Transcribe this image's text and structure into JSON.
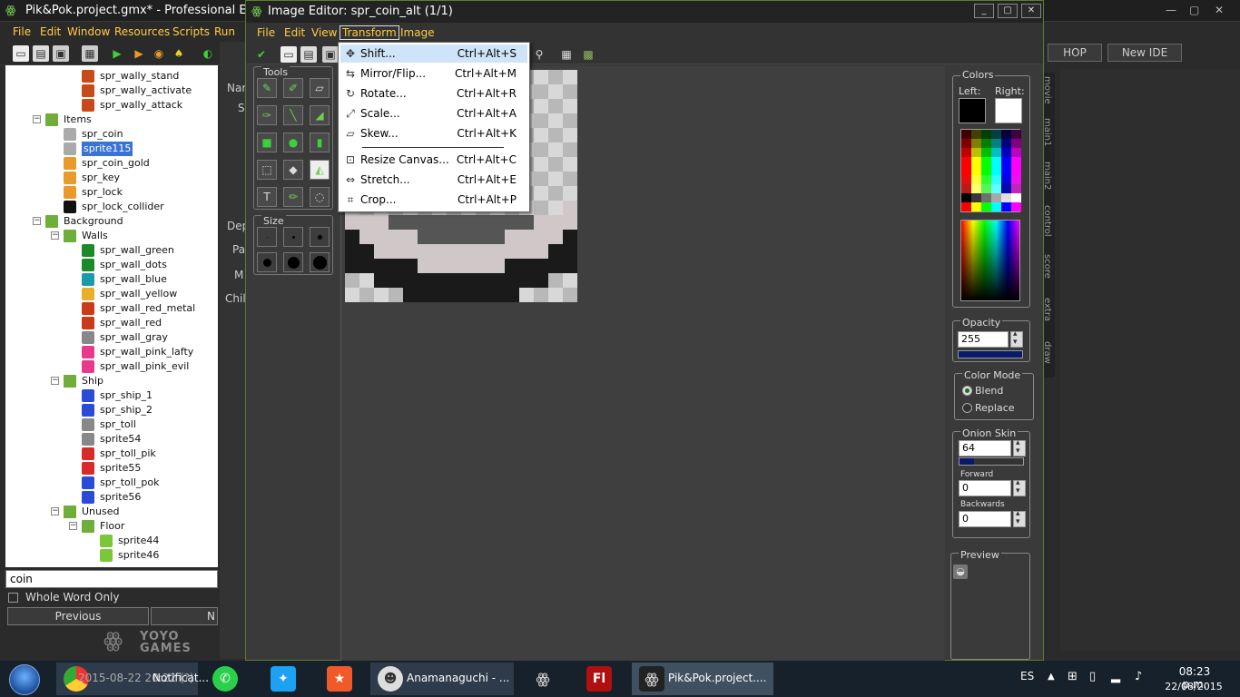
{
  "main": {
    "title": "Pik&Pok.project.gmx*  -  Professional Edition",
    "menu": [
      "File",
      "Edit",
      "Window",
      "Resources",
      "Scripts",
      "Run"
    ],
    "right_buttons": [
      "HOP",
      "New IDE"
    ],
    "right_tabs": [
      "movie",
      "main1",
      "main2",
      "control",
      "score",
      "extra",
      "draw"
    ]
  },
  "tree": {
    "items": [
      {
        "label": "spr_wally_stand",
        "depth": 4,
        "type": "sprite",
        "color": "#c84a1a"
      },
      {
        "label": "spr_wally_activate",
        "depth": 4,
        "type": "sprite",
        "color": "#c84a1a"
      },
      {
        "label": "spr_wally_attack",
        "depth": 4,
        "type": "sprite",
        "color": "#c84a1a"
      },
      {
        "label": "Items",
        "depth": 2,
        "type": "folder"
      },
      {
        "label": "spr_coin",
        "depth": 3,
        "type": "sprite",
        "color": "#aaaaaa"
      },
      {
        "label": "sprite115",
        "depth": 3,
        "type": "sprite",
        "color": "#aaaaaa",
        "selected": true
      },
      {
        "label": "spr_coin_gold",
        "depth": 3,
        "type": "sprite",
        "color": "#e89a2a"
      },
      {
        "label": "spr_key",
        "depth": 3,
        "type": "sprite",
        "color": "#e89a2a"
      },
      {
        "label": "spr_lock",
        "depth": 3,
        "type": "sprite",
        "color": "#e89a2a"
      },
      {
        "label": "spr_lock_collider",
        "depth": 3,
        "type": "sprite",
        "color": "#111111"
      },
      {
        "label": "Background",
        "depth": 2,
        "type": "folder"
      },
      {
        "label": "Walls",
        "depth": 3,
        "type": "folder"
      },
      {
        "label": "spr_wall_green",
        "depth": 4,
        "type": "sprite",
        "color": "#1a8a2a"
      },
      {
        "label": "spr_wall_dots",
        "depth": 4,
        "type": "sprite",
        "color": "#1a8a2a"
      },
      {
        "label": "spr_wall_blue",
        "depth": 4,
        "type": "sprite",
        "color": "#1a9aaa"
      },
      {
        "label": "spr_wall_yellow",
        "depth": 4,
        "type": "sprite",
        "color": "#e8b02a"
      },
      {
        "label": "spr_wall_red_metal",
        "depth": 4,
        "type": "sprite",
        "color": "#c83a1a"
      },
      {
        "label": "spr_wall_red",
        "depth": 4,
        "type": "sprite",
        "color": "#c83a1a"
      },
      {
        "label": "spr_wall_gray",
        "depth": 4,
        "type": "sprite",
        "color": "#888888"
      },
      {
        "label": "spr_wall_pink_lafty",
        "depth": 4,
        "type": "sprite",
        "color": "#e83a8a"
      },
      {
        "label": "spr_wall_pink_evil",
        "depth": 4,
        "type": "sprite",
        "color": "#e83a8a"
      },
      {
        "label": "Ship",
        "depth": 3,
        "type": "folder"
      },
      {
        "label": "spr_ship_1",
        "depth": 4,
        "type": "sprite",
        "color": "#2a4ad8"
      },
      {
        "label": "spr_ship_2",
        "depth": 4,
        "type": "sprite",
        "color": "#2a4ad8"
      },
      {
        "label": "spr_toll",
        "depth": 4,
        "type": "sprite",
        "color": "#888888"
      },
      {
        "label": "sprite54",
        "depth": 4,
        "type": "sprite",
        "color": "#888888"
      },
      {
        "label": "spr_toll_pik",
        "depth": 4,
        "type": "sprite",
        "color": "#d82a2a"
      },
      {
        "label": "sprite55",
        "depth": 4,
        "type": "sprite",
        "color": "#d82a2a"
      },
      {
        "label": "spr_toll_pok",
        "depth": 4,
        "type": "sprite",
        "color": "#2a4ad8"
      },
      {
        "label": "sprite56",
        "depth": 4,
        "type": "sprite",
        "color": "#2a4ad8"
      },
      {
        "label": "Unused",
        "depth": 3,
        "type": "folder"
      },
      {
        "label": "Floor",
        "depth": 4,
        "type": "folder"
      },
      {
        "label": "sprite44",
        "depth": 5,
        "type": "sprite",
        "color": "#7ac83a"
      },
      {
        "label": "sprite46",
        "depth": 5,
        "type": "sprite",
        "color": "#7ac83a"
      }
    ],
    "search_value": "coin",
    "whole_word_label": "Whole Word Only",
    "previous_label": "Previous",
    "next_label": "N"
  },
  "logo": {
    "line1": "YOYO",
    "line2": "GAMES"
  },
  "mid_panel": {
    "labels": [
      "Nar",
      "S",
      "Dep",
      "Pa",
      "M",
      "Chil"
    ]
  },
  "editor": {
    "title": "Image Editor: spr_coin_alt (1/1)",
    "menu": [
      "File",
      "Edit",
      "View",
      "Transform",
      "Image"
    ],
    "active_menu": "Transform",
    "tools_caption": "Tools",
    "size_caption": "Size",
    "colors_caption": "Colors",
    "left_label": "Left:",
    "right_label": "Right:",
    "opacity_caption": "Opacity",
    "opacity_value": "255",
    "color_mode_caption": "Color Mode",
    "blend_label": "Blend",
    "replace_label": "Replace",
    "onion_caption": "Onion Skin",
    "onion_value": "64",
    "forward_label": "Forward",
    "forward_value": "0",
    "backwards_label": "Backwards",
    "backwards_value": "0",
    "preview_caption": "Preview"
  },
  "transform_menu": [
    {
      "label": "Shift...",
      "shortcut": "Ctrl+Alt+S",
      "icon": "move-icon"
    },
    {
      "label": "Mirror/Flip...",
      "shortcut": "Ctrl+Alt+M",
      "icon": "mirror-icon"
    },
    {
      "label": "Rotate...",
      "shortcut": "Ctrl+Alt+R",
      "icon": "rotate-icon"
    },
    {
      "label": "Scale...",
      "shortcut": "Ctrl+Alt+A",
      "icon": "scale-icon"
    },
    {
      "label": "Skew...",
      "shortcut": "Ctrl+Alt+K",
      "icon": "skew-icon"
    },
    {
      "label": "Resize Canvas...",
      "shortcut": "Ctrl+Alt+C",
      "icon": "resize-canvas-icon"
    },
    {
      "label": "Stretch...",
      "shortcut": "Ctrl+Alt+E",
      "icon": "stretch-icon"
    },
    {
      "label": "Crop...",
      "shortcut": "Ctrl+Alt+P",
      "icon": "crop-icon"
    }
  ],
  "taskbar": {
    "apps": [
      {
        "label": "Notificat...",
        "icon": "chrome-icon"
      },
      {
        "label": "",
        "icon": "whatsapp-icon"
      },
      {
        "label": "",
        "icon": "twitter-icon"
      },
      {
        "label": "",
        "icon": "bookmark-icon"
      },
      {
        "label": "Anamanaguchi - ...",
        "icon": "music-icon"
      },
      {
        "label": "",
        "icon": "gamemaker-icon"
      },
      {
        "label": "Fl",
        "icon": "flash-icon"
      },
      {
        "label": "Pik&Pok.project....",
        "icon": "gamemaker-icon"
      }
    ],
    "chrome_overlay": "2015-08-22 20:22 (?)",
    "lang": "ES",
    "time": "08:23 p.m.",
    "date": "22/08/2015"
  }
}
